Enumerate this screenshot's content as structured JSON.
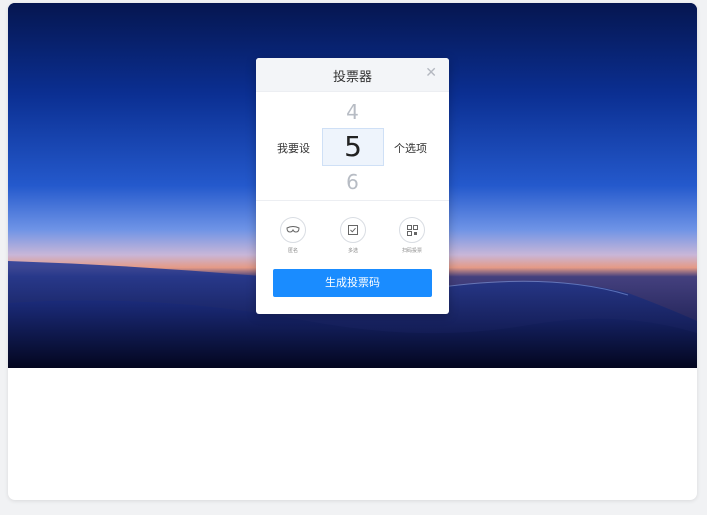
{
  "dialog": {
    "title": "投票器",
    "close_icon": "close-icon",
    "picker": {
      "prefix_label": "我要设",
      "suffix_label": "个选项",
      "prev_value": "4",
      "current_value": "5",
      "next_value": "6"
    },
    "vote_types": [
      {
        "label": "匿名",
        "icon": "mask-icon"
      },
      {
        "label": "多选",
        "icon": "checkbox-icon"
      },
      {
        "label": "扫码投票",
        "icon": "qrcode-icon"
      }
    ],
    "submit_label": "生成投票码"
  },
  "colors": {
    "accent": "#1a8cff",
    "hero_top": "#061a55",
    "hero_horizon": "#d98c8a"
  }
}
